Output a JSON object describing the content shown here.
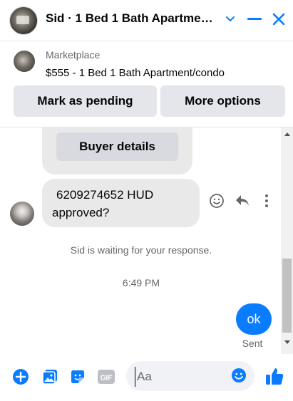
{
  "header": {
    "title": "Sid · 1 Bed 1 Bath Apartme…"
  },
  "listing": {
    "source": "Marketplace",
    "title": "$555 - 1 Bed 1 Bath Apartment/condo",
    "actions": {
      "mark_pending": "Mark as pending",
      "more_options": "More options"
    }
  },
  "messages": {
    "buyer_details_label": "Buyer details",
    "incoming_text_line1": "6209274652 HUD",
    "incoming_text_line2": "approved?",
    "waiting_notice": "Sid is waiting for your response.",
    "timestamp": "6:49 PM",
    "outgoing_text": "ok",
    "outgoing_status": "Sent"
  },
  "composer": {
    "placeholder": "Aa",
    "value": ""
  },
  "colors": {
    "accent": "#0a7cff",
    "bubble_incoming": "#e9e9ea",
    "button_bg": "#e4e6eb",
    "muted_text": "#65676b"
  },
  "icons": {
    "header": [
      "chevron-down-icon",
      "minimize-icon",
      "close-icon"
    ],
    "message_actions": [
      "smiley-icon",
      "reply-icon",
      "more-vertical-icon"
    ],
    "composer": [
      "plus-circle-icon",
      "photo-icon",
      "sticker-icon",
      "gif-icon",
      "emoji-icon",
      "thumbs-up-icon"
    ]
  }
}
